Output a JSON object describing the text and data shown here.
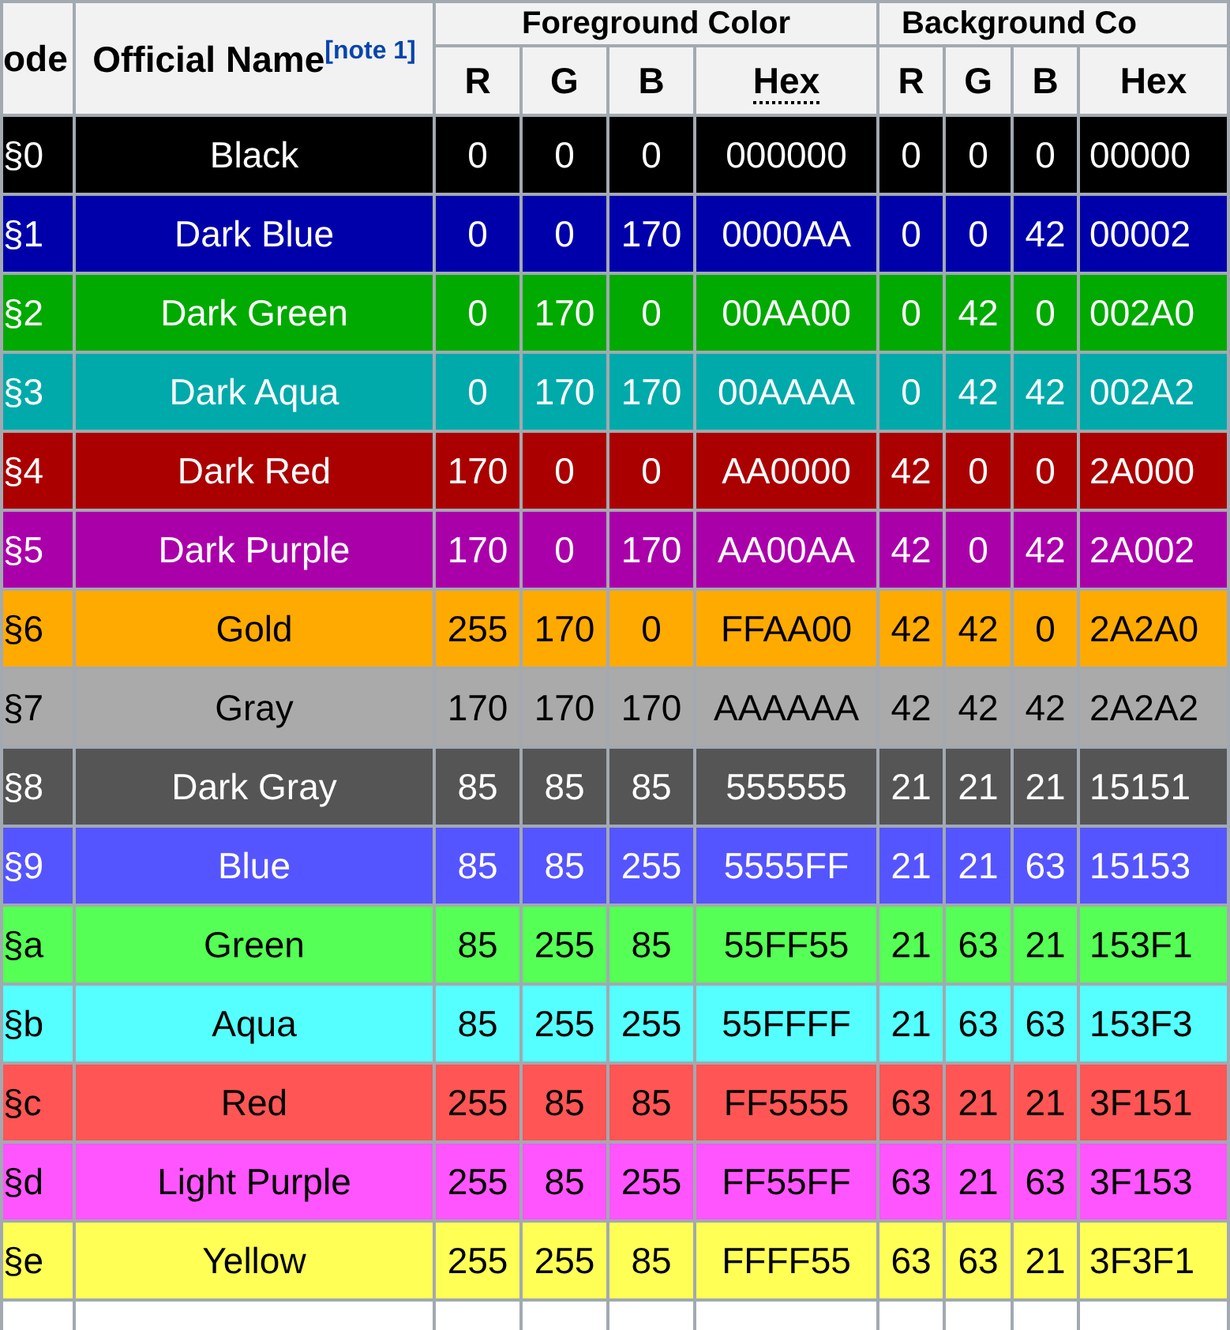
{
  "table": {
    "columns": {
      "code": "ode",
      "name": "Official Name",
      "name_note": "[note 1]",
      "foreground_group": "Foreground Color",
      "background_group": "Background Co",
      "foreground": [
        "R",
        "G",
        "B",
        "Hex"
      ],
      "background": [
        "R",
        "G",
        "B",
        "Hex"
      ]
    },
    "rows": [
      {
        "code": "§0",
        "name": "Black",
        "fg": [
          "0",
          "0",
          "0",
          "000000"
        ],
        "bg": [
          "0",
          "0",
          "0",
          "00000"
        ],
        "color": "#000000"
      },
      {
        "code": "§1",
        "name": "Dark Blue",
        "fg": [
          "0",
          "0",
          "170",
          "0000AA"
        ],
        "bg": [
          "0",
          "0",
          "42",
          "00002"
        ],
        "color": "#0000aa"
      },
      {
        "code": "§2",
        "name": "Dark Green",
        "fg": [
          "0",
          "170",
          "0",
          "00AA00"
        ],
        "bg": [
          "0",
          "42",
          "0",
          "002A0"
        ],
        "color": "#00aa00"
      },
      {
        "code": "§3",
        "name": "Dark Aqua",
        "fg": [
          "0",
          "170",
          "170",
          "00AAAA"
        ],
        "bg": [
          "0",
          "42",
          "42",
          "002A2"
        ],
        "color": "#00aaaa"
      },
      {
        "code": "§4",
        "name": "Dark Red",
        "fg": [
          "170",
          "0",
          "0",
          "AA0000"
        ],
        "bg": [
          "42",
          "0",
          "0",
          "2A000"
        ],
        "color": "#aa0000"
      },
      {
        "code": "§5",
        "name": "Dark Purple",
        "fg": [
          "170",
          "0",
          "170",
          "AA00AA"
        ],
        "bg": [
          "42",
          "0",
          "42",
          "2A002"
        ],
        "color": "#aa00aa"
      },
      {
        "code": "§6",
        "name": "Gold",
        "fg": [
          "255",
          "170",
          "0",
          "FFAA00"
        ],
        "bg": [
          "42",
          "42",
          "0",
          "2A2A0"
        ],
        "color": "#ffaa00"
      },
      {
        "code": "§7",
        "name": "Gray",
        "fg": [
          "170",
          "170",
          "170",
          "AAAAAA"
        ],
        "bg": [
          "42",
          "42",
          "42",
          "2A2A2"
        ],
        "color": "#aaaaaa"
      },
      {
        "code": "§8",
        "name": "Dark Gray",
        "fg": [
          "85",
          "85",
          "85",
          "555555"
        ],
        "bg": [
          "21",
          "21",
          "21",
          "15151"
        ],
        "color": "#555555"
      },
      {
        "code": "§9",
        "name": "Blue",
        "fg": [
          "85",
          "85",
          "255",
          "5555FF"
        ],
        "bg": [
          "21",
          "21",
          "63",
          "15153"
        ],
        "color": "#5555ff"
      },
      {
        "code": "§a",
        "name": "Green",
        "fg": [
          "85",
          "255",
          "85",
          "55FF55"
        ],
        "bg": [
          "21",
          "63",
          "21",
          "153F1"
        ],
        "color": "#55ff55"
      },
      {
        "code": "§b",
        "name": "Aqua",
        "fg": [
          "85",
          "255",
          "255",
          "55FFFF"
        ],
        "bg": [
          "21",
          "63",
          "63",
          "153F3"
        ],
        "color": "#55ffff"
      },
      {
        "code": "§c",
        "name": "Red",
        "fg": [
          "255",
          "85",
          "85",
          "FF5555"
        ],
        "bg": [
          "63",
          "21",
          "21",
          "3F151"
        ],
        "color": "#ff5555"
      },
      {
        "code": "§d",
        "name": "Light Purple",
        "fg": [
          "255",
          "85",
          "255",
          "FF55FF"
        ],
        "bg": [
          "63",
          "21",
          "63",
          "3F153"
        ],
        "color": "#ff55ff"
      },
      {
        "code": "§e",
        "name": "Yellow",
        "fg": [
          "255",
          "255",
          "85",
          "FFFF55"
        ],
        "bg": [
          "63",
          "63",
          "21",
          "3F3F1"
        ],
        "color": "#ffff55"
      }
    ]
  }
}
